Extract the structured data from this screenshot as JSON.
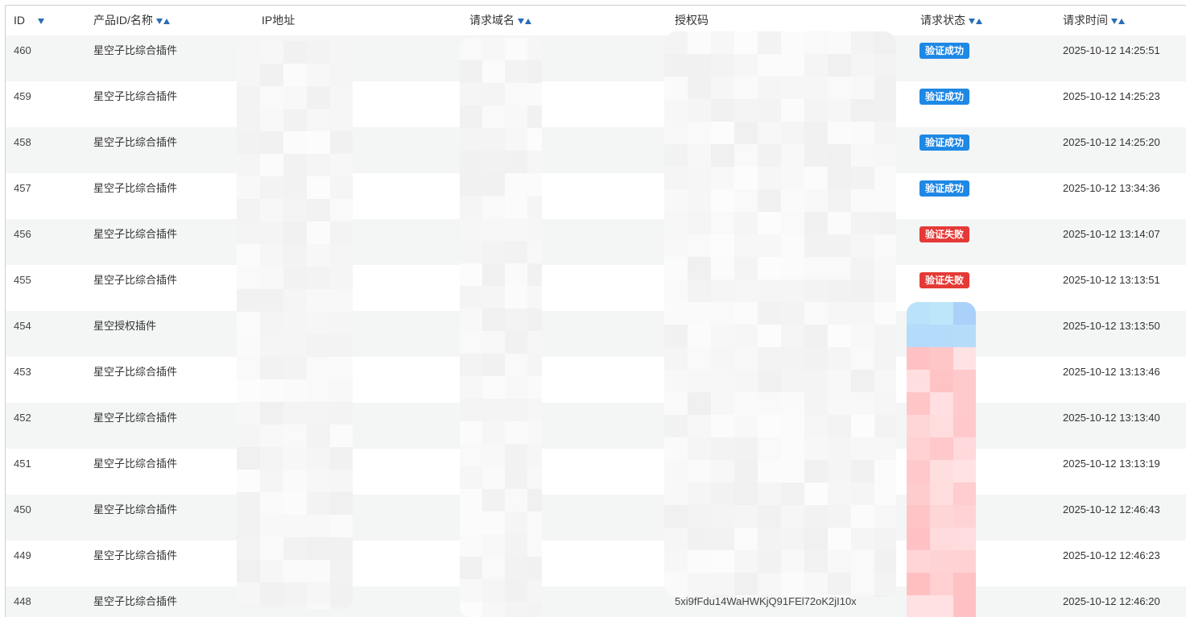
{
  "table": {
    "columns": [
      {
        "key": "id",
        "label": "ID"
      },
      {
        "key": "product",
        "label": "产品ID/名称"
      },
      {
        "key": "ip",
        "label": "IP地址"
      },
      {
        "key": "domain",
        "label": "请求域名"
      },
      {
        "key": "auth_code",
        "label": "授权码"
      },
      {
        "key": "status",
        "label": "请求状态"
      },
      {
        "key": "time",
        "label": "请求时间"
      }
    ],
    "rows": [
      {
        "id": "460",
        "product": "星空子比综合插件",
        "status": "验证成功",
        "status_type": "ok",
        "time": "2025-10-12 14:25:51",
        "auth_code": ""
      },
      {
        "id": "459",
        "product": "星空子比综合插件",
        "status": "验证成功",
        "status_type": "ok",
        "time": "2025-10-12 14:25:23",
        "auth_code": ""
      },
      {
        "id": "458",
        "product": "星空子比综合插件",
        "status": "验证成功",
        "status_type": "ok",
        "time": "2025-10-12 14:25:20",
        "auth_code": ""
      },
      {
        "id": "457",
        "product": "星空子比综合插件",
        "status": "验证成功",
        "status_type": "ok",
        "time": "2025-10-12 13:34:36",
        "auth_code": ""
      },
      {
        "id": "456",
        "product": "星空子比综合插件",
        "status": "验证失败",
        "status_type": "fail",
        "time": "2025-10-12 13:14:07",
        "auth_code": ""
      },
      {
        "id": "455",
        "product": "星空子比综合插件",
        "status": "验证失败",
        "status_type": "fail",
        "time": "2025-10-12 13:13:51",
        "auth_code": ""
      },
      {
        "id": "454",
        "product": "星空授权插件",
        "status": "",
        "status_type": "",
        "time": "2025-10-12 13:13:50",
        "auth_code": ""
      },
      {
        "id": "453",
        "product": "星空子比综合插件",
        "status": "",
        "status_type": "",
        "time": "2025-10-12 13:13:46",
        "auth_code": ""
      },
      {
        "id": "452",
        "product": "星空子比综合插件",
        "status": "",
        "status_type": "",
        "time": "2025-10-12 13:13:40",
        "auth_code": ""
      },
      {
        "id": "451",
        "product": "星空子比综合插件",
        "status": "",
        "status_type": "",
        "time": "2025-10-12 13:13:19",
        "auth_code": ""
      },
      {
        "id": "450",
        "product": "星空子比综合插件",
        "status": "",
        "status_type": "",
        "time": "2025-10-12 12:46:43",
        "auth_code": ""
      },
      {
        "id": "449",
        "product": "星空子比综合插件",
        "status": "",
        "status_type": "",
        "time": "2025-10-12 12:46:23",
        "auth_code": ""
      },
      {
        "id": "448",
        "product": "星空子比综合插件",
        "status": "",
        "status_type": "",
        "time": "2025-10-12 12:46:20",
        "auth_code": "5xi9fFdu14WaHWKjQ91FEl72oK2jI10x"
      }
    ]
  },
  "colors": {
    "badge_ok": "#1e88e5",
    "badge_fail": "#e53935",
    "sort_arrow": "#2a6db5",
    "row_stripe": "#f4f5f5"
  }
}
